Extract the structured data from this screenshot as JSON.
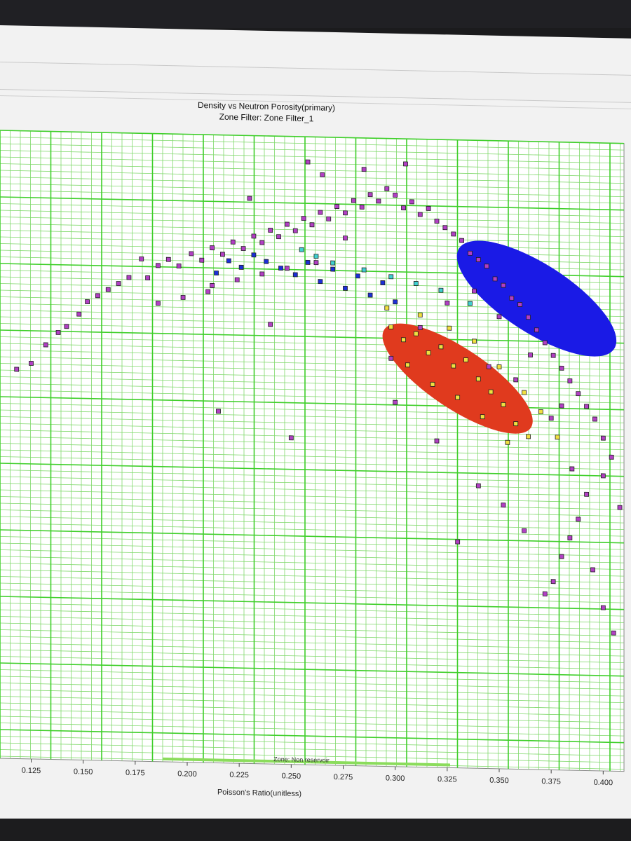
{
  "chart_data": {
    "type": "scatter",
    "title": "Density vs Neutron Porosity(primary)",
    "subtitle": "Zone Filter: Zone Filter_1",
    "xlabel": "Poisson's Ratio(unitless)",
    "ylabel": "",
    "x_ticks": [
      "0.125",
      "0.150",
      "0.175",
      "0.200",
      "0.225",
      "0.250",
      "0.275",
      "0.300",
      "0.325",
      "0.350",
      "0.375",
      "0.400"
    ],
    "xlim": [
      0.11,
      0.41
    ],
    "ylim": [
      0,
      1
    ],
    "grid": true,
    "annotation": "Zone: Non reservoir",
    "series": [
      {
        "color": "#b23fc4",
        "points": [
          [
            0.118,
            0.62
          ],
          [
            0.125,
            0.63
          ],
          [
            0.132,
            0.66
          ],
          [
            0.138,
            0.68
          ],
          [
            0.142,
            0.69
          ],
          [
            0.148,
            0.71
          ],
          [
            0.152,
            0.73
          ],
          [
            0.157,
            0.74
          ],
          [
            0.162,
            0.75
          ],
          [
            0.167,
            0.76
          ],
          [
            0.172,
            0.77
          ],
          [
            0.178,
            0.8
          ],
          [
            0.181,
            0.77
          ],
          [
            0.186,
            0.79
          ],
          [
            0.191,
            0.8
          ],
          [
            0.196,
            0.79
          ],
          [
            0.202,
            0.81
          ],
          [
            0.207,
            0.8
          ],
          [
            0.212,
            0.82
          ],
          [
            0.217,
            0.81
          ],
          [
            0.222,
            0.83
          ],
          [
            0.227,
            0.82
          ],
          [
            0.232,
            0.84
          ],
          [
            0.236,
            0.83
          ],
          [
            0.24,
            0.85
          ],
          [
            0.244,
            0.84
          ],
          [
            0.248,
            0.86
          ],
          [
            0.252,
            0.85
          ],
          [
            0.256,
            0.87
          ],
          [
            0.26,
            0.86
          ],
          [
            0.264,
            0.88
          ],
          [
            0.268,
            0.87
          ],
          [
            0.272,
            0.89
          ],
          [
            0.276,
            0.88
          ],
          [
            0.28,
            0.9
          ],
          [
            0.284,
            0.89
          ],
          [
            0.288,
            0.91
          ],
          [
            0.292,
            0.9
          ],
          [
            0.296,
            0.92
          ],
          [
            0.3,
            0.91
          ],
          [
            0.304,
            0.89
          ],
          [
            0.308,
            0.9
          ],
          [
            0.312,
            0.88
          ],
          [
            0.316,
            0.89
          ],
          [
            0.32,
            0.87
          ],
          [
            0.324,
            0.86
          ],
          [
            0.328,
            0.85
          ],
          [
            0.332,
            0.84
          ],
          [
            0.336,
            0.82
          ],
          [
            0.34,
            0.81
          ],
          [
            0.344,
            0.8
          ],
          [
            0.348,
            0.78
          ],
          [
            0.352,
            0.77
          ],
          [
            0.356,
            0.75
          ],
          [
            0.36,
            0.74
          ],
          [
            0.364,
            0.72
          ],
          [
            0.368,
            0.7
          ],
          [
            0.372,
            0.68
          ],
          [
            0.376,
            0.66
          ],
          [
            0.38,
            0.64
          ],
          [
            0.384,
            0.62
          ],
          [
            0.388,
            0.6
          ],
          [
            0.392,
            0.58
          ],
          [
            0.396,
            0.56
          ],
          [
            0.4,
            0.53
          ],
          [
            0.404,
            0.5
          ],
          [
            0.392,
            0.44
          ],
          [
            0.388,
            0.4
          ],
          [
            0.384,
            0.37
          ],
          [
            0.38,
            0.34
          ],
          [
            0.376,
            0.3
          ],
          [
            0.372,
            0.28
          ],
          [
            0.395,
            0.32
          ],
          [
            0.4,
            0.26
          ],
          [
            0.405,
            0.22
          ],
          [
            0.34,
            0.45
          ],
          [
            0.352,
            0.42
          ],
          [
            0.362,
            0.38
          ],
          [
            0.33,
            0.36
          ],
          [
            0.32,
            0.52
          ],
          [
            0.3,
            0.58
          ],
          [
            0.25,
            0.52
          ],
          [
            0.215,
            0.56
          ],
          [
            0.24,
            0.7
          ],
          [
            0.265,
            0.94
          ],
          [
            0.285,
            0.95
          ],
          [
            0.258,
            0.96
          ],
          [
            0.305,
            0.96
          ],
          [
            0.23,
            0.9
          ],
          [
            0.212,
            0.76
          ],
          [
            0.345,
            0.64
          ],
          [
            0.358,
            0.62
          ],
          [
            0.375,
            0.56
          ],
          [
            0.385,
            0.48
          ],
          [
            0.4,
            0.47
          ],
          [
            0.408,
            0.42
          ],
          [
            0.298,
            0.65
          ],
          [
            0.312,
            0.7
          ],
          [
            0.325,
            0.74
          ],
          [
            0.338,
            0.76
          ],
          [
            0.35,
            0.72
          ],
          [
            0.365,
            0.66
          ],
          [
            0.38,
            0.58
          ],
          [
            0.276,
            0.84
          ],
          [
            0.262,
            0.8
          ],
          [
            0.248,
            0.79
          ],
          [
            0.236,
            0.78
          ],
          [
            0.224,
            0.77
          ],
          [
            0.21,
            0.75
          ],
          [
            0.198,
            0.74
          ],
          [
            0.186,
            0.73
          ]
        ]
      },
      {
        "color": "#1b2fd8",
        "points": [
          [
            0.245,
            0.79
          ],
          [
            0.252,
            0.78
          ],
          [
            0.258,
            0.8
          ],
          [
            0.264,
            0.77
          ],
          [
            0.27,
            0.79
          ],
          [
            0.276,
            0.76
          ],
          [
            0.282,
            0.78
          ],
          [
            0.288,
            0.75
          ],
          [
            0.294,
            0.77
          ],
          [
            0.3,
            0.74
          ],
          [
            0.238,
            0.8
          ],
          [
            0.232,
            0.81
          ],
          [
            0.226,
            0.79
          ],
          [
            0.22,
            0.8
          ],
          [
            0.214,
            0.78
          ]
        ]
      },
      {
        "color": "#40d0d0",
        "points": [
          [
            0.255,
            0.82
          ],
          [
            0.262,
            0.81
          ],
          [
            0.27,
            0.8
          ],
          [
            0.285,
            0.79
          ],
          [
            0.298,
            0.78
          ],
          [
            0.31,
            0.77
          ],
          [
            0.322,
            0.76
          ],
          [
            0.336,
            0.74
          ]
        ]
      },
      {
        "color": "#f0e040",
        "points": [
          [
            0.298,
            0.7
          ],
          [
            0.304,
            0.68
          ],
          [
            0.31,
            0.69
          ],
          [
            0.316,
            0.66
          ],
          [
            0.322,
            0.67
          ],
          [
            0.328,
            0.64
          ],
          [
            0.334,
            0.65
          ],
          [
            0.34,
            0.62
          ],
          [
            0.346,
            0.6
          ],
          [
            0.352,
            0.58
          ],
          [
            0.358,
            0.55
          ],
          [
            0.364,
            0.53
          ],
          [
            0.306,
            0.64
          ],
          [
            0.318,
            0.61
          ],
          [
            0.33,
            0.59
          ],
          [
            0.342,
            0.56
          ],
          [
            0.354,
            0.52
          ],
          [
            0.296,
            0.73
          ],
          [
            0.312,
            0.72
          ],
          [
            0.326,
            0.7
          ],
          [
            0.338,
            0.68
          ],
          [
            0.35,
            0.64
          ],
          [
            0.362,
            0.6
          ],
          [
            0.37,
            0.57
          ],
          [
            0.378,
            0.53
          ]
        ]
      }
    ],
    "ellipses": [
      {
        "color": "#1a1ae6",
        "cx": 0.368,
        "cy": 0.75,
        "rx": 0.044,
        "ry": 0.055,
        "angle": 32
      },
      {
        "color": "#e03a1e",
        "cx": 0.33,
        "cy": 0.62,
        "rx": 0.042,
        "ry": 0.048,
        "angle": 33
      }
    ]
  }
}
